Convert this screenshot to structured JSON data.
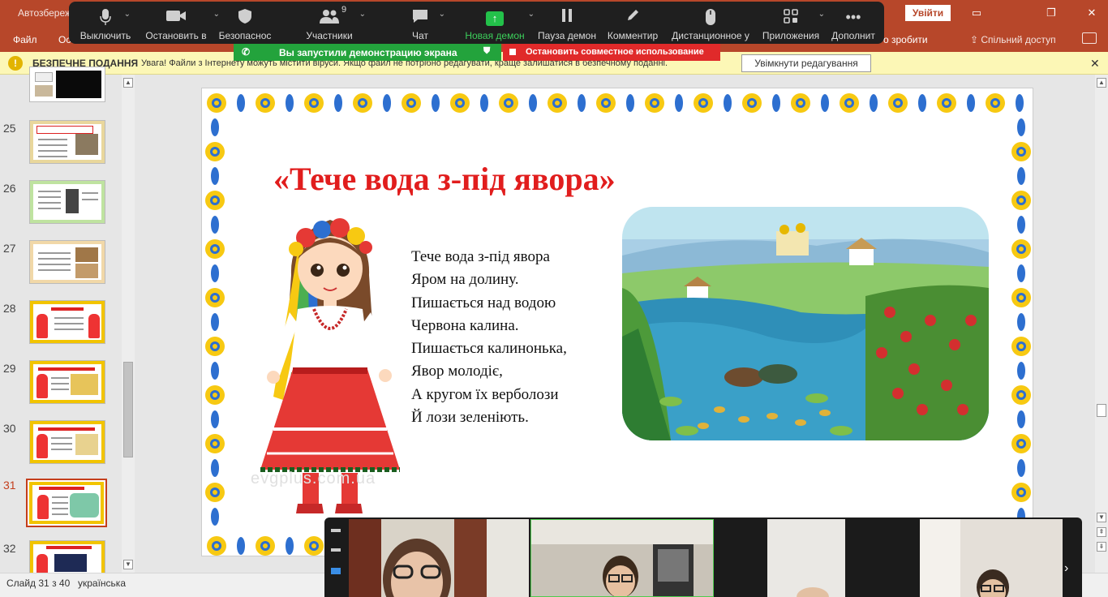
{
  "window": {
    "doc_title": "Автозбереж",
    "login_label": "Увійти",
    "min_icon": "restore-down-icon",
    "controls": [
      "▭",
      "❐",
      "✕"
    ]
  },
  "ribbon": {
    "tabs": [
      "Файл",
      "Ос",
      "о зробити"
    ],
    "share_label": "Спільний доступ",
    "share_icon": "share-icon"
  },
  "zoom_toolbar": {
    "items": [
      {
        "label": "Выключить",
        "icon": "microphone-icon"
      },
      {
        "label": "Остановить в",
        "icon": "video-camera-icon"
      },
      {
        "label": "Безопаснос",
        "icon": "shield-icon"
      },
      {
        "label": "Участники",
        "icon": "participants-icon",
        "count": "9"
      },
      {
        "label": "Чат",
        "icon": "chat-icon"
      },
      {
        "label": "Новая демон",
        "icon": "share-screen-icon"
      },
      {
        "label": "Пауза демон",
        "icon": "pause-icon"
      },
      {
        "label": "Комментир",
        "icon": "pencil-icon"
      },
      {
        "label": "Дистанционное у",
        "icon": "mouse-icon"
      },
      {
        "label": "Приложения",
        "icon": "apps-icon"
      },
      {
        "label": "Дополнит",
        "icon": "more-icon"
      }
    ]
  },
  "sharing": {
    "banner_text": "Вы запустили демонстрацию экрана",
    "stop_text": "Остановить совместное использование"
  },
  "protected_view": {
    "title": "БЕЗПЕЧНЕ ПОДАННЯ",
    "message": "Увага! Файли з Інтернету можуть містити віруси. Якщо файл не потрібно редагувати, краще залишатися в безпечному поданні.",
    "enable_label": "Увімкнути редагування",
    "close_label": "✕"
  },
  "thumbnails": [
    {
      "num": "",
      "selected": false
    },
    {
      "num": "25",
      "selected": false
    },
    {
      "num": "26",
      "selected": false
    },
    {
      "num": "27",
      "selected": false
    },
    {
      "num": "28",
      "selected": false
    },
    {
      "num": "29",
      "selected": false
    },
    {
      "num": "30",
      "selected": false
    },
    {
      "num": "31",
      "selected": true
    },
    {
      "num": "32",
      "selected": false
    }
  ],
  "slide": {
    "title": "«Тече вода з-під явора»",
    "poem": [
      "Тече вода з-під явора",
      "Яром на долину.",
      "Пишається над водою",
      "Червона калина.",
      "Пишається калинонька,",
      "Явор молодіє,",
      "А кругом їх верболози",
      "Й лози зеленіють."
    ],
    "watermark": "evgplus.com.ua",
    "colors": {
      "title": "#e11d1d",
      "border_yellow": "#f7c912",
      "border_blue": "#2d6fd0"
    }
  },
  "status": {
    "slide_info": "Слайд 31 з 40",
    "language": "українська"
  }
}
